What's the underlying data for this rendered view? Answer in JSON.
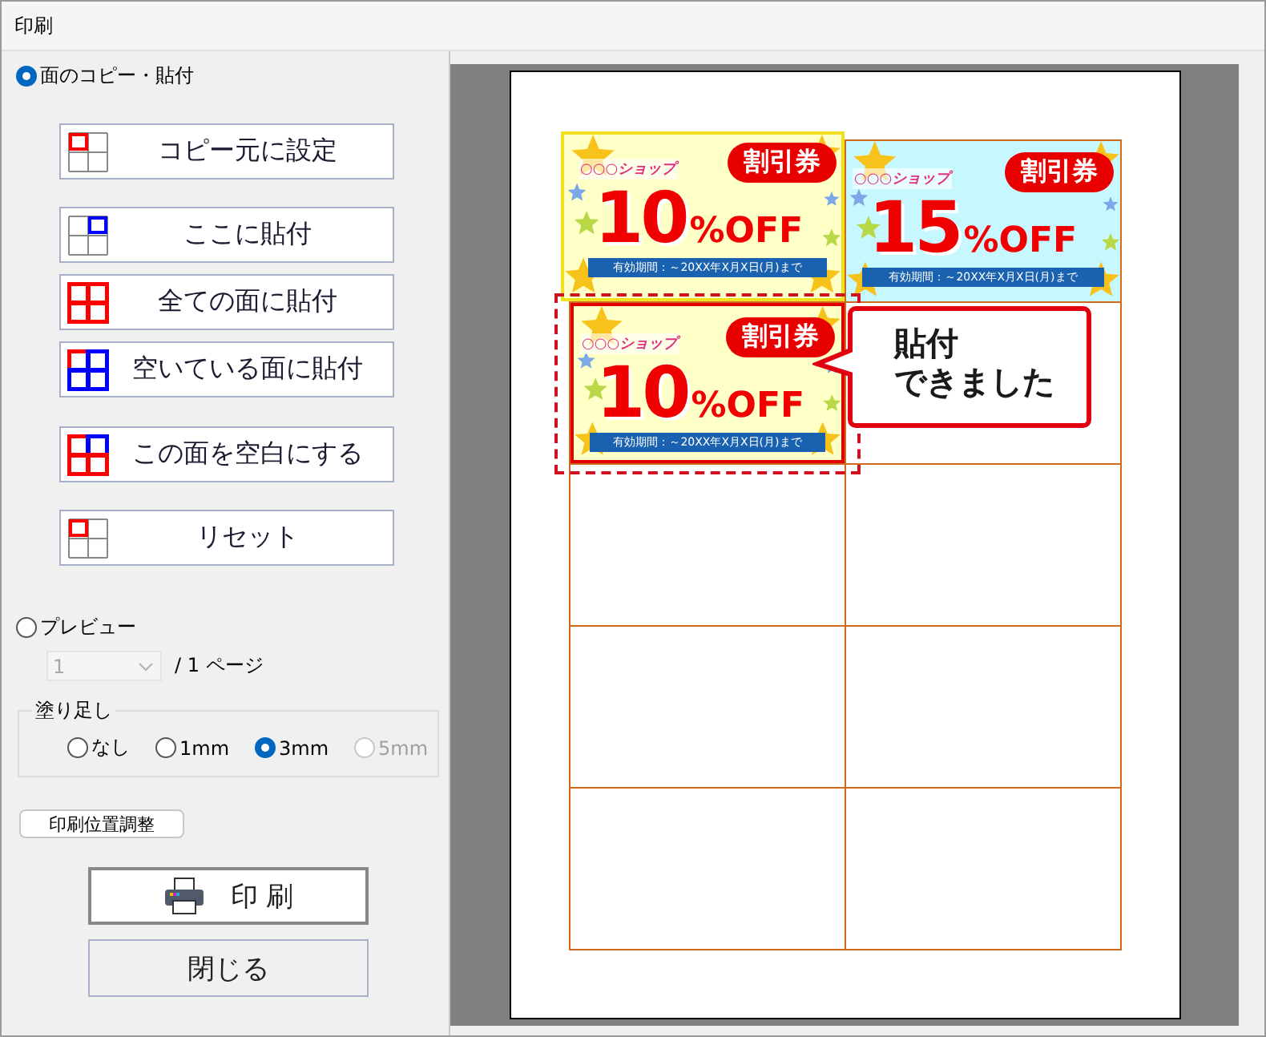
{
  "window": {
    "title": "印刷"
  },
  "copy_paste": {
    "label": "面のコピー・貼付",
    "selected": true,
    "buttons": [
      {
        "kind": "set-source",
        "label": "コピー元に設定"
      },
      {
        "kind": "paste-here",
        "label": "ここに貼付"
      },
      {
        "kind": "paste-all",
        "label": "全ての面に貼付"
      },
      {
        "kind": "paste-empty",
        "label": "空いている面に貼付"
      },
      {
        "kind": "clear",
        "label": "この面を空白にする"
      },
      {
        "kind": "reset",
        "label": "リセット"
      }
    ]
  },
  "preview": {
    "label": "プレビュー",
    "selected": false,
    "page_select": {
      "value": "1",
      "disabled": true
    },
    "page_total": "/ 1 ページ"
  },
  "bleed": {
    "legend": "塗り足し",
    "options": [
      {
        "label": "なし",
        "selected": false,
        "disabled": false
      },
      {
        "label": "1mm",
        "selected": false,
        "disabled": false
      },
      {
        "label": "3mm",
        "selected": true,
        "disabled": false
      },
      {
        "label": "5mm",
        "selected": false,
        "disabled": true
      }
    ]
  },
  "adjust_button": "印刷位置調整",
  "print_button": "印 刷",
  "close_button": "閉じる",
  "sheet": {
    "cells": [
      {
        "kind": "coupon",
        "color": "#ffffc8",
        "source": true,
        "pasted": false,
        "shop": "○○○ショップ",
        "badge": "割引券",
        "rate": "10",
        "unit": "%OFF",
        "validity": "有効期間：～20XX年X月X日(月)まで"
      },
      {
        "kind": "coupon",
        "color": "#c8f8ff",
        "source": false,
        "pasted": false,
        "shop": "○○○ショップ",
        "badge": "割引券",
        "rate": "15",
        "unit": "%OFF",
        "validity": "有効期間：～20XX年X月X日(月)まで"
      },
      {
        "kind": "coupon",
        "color": "#ffffc8",
        "source": false,
        "pasted": true,
        "shop": "○○○ショップ",
        "badge": "割引券",
        "rate": "10",
        "unit": "%OFF",
        "validity": "有効期間：～20XX年X月X日(月)まで"
      },
      {
        "kind": "empty"
      },
      {
        "kind": "empty"
      },
      {
        "kind": "empty"
      },
      {
        "kind": "empty"
      },
      {
        "kind": "empty"
      },
      {
        "kind": "empty"
      },
      {
        "kind": "empty"
      }
    ],
    "callout": [
      "貼付",
      "できました"
    ]
  }
}
